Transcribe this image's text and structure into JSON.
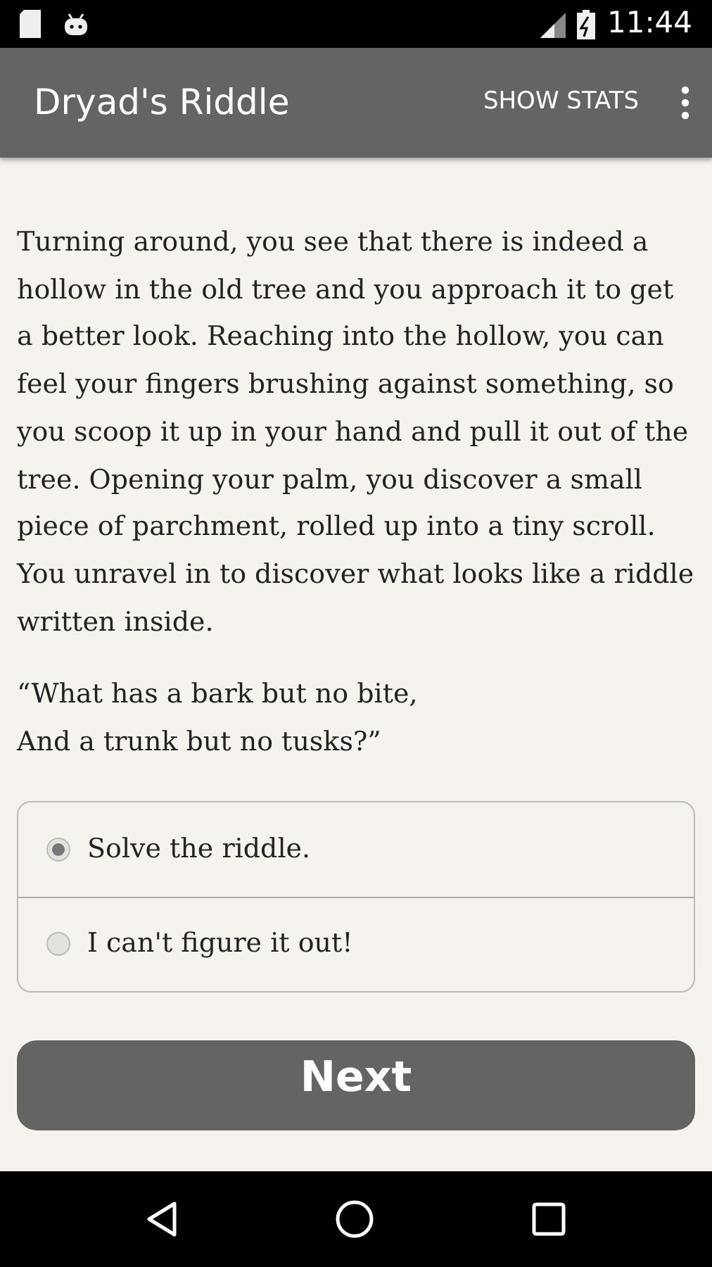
{
  "status_bar": {
    "time": "11:44"
  },
  "app_bar": {
    "title": "Dryad's Riddle",
    "action": "SHOW STATS"
  },
  "story": "Turning around, you see that there is indeed a hollow in the old tree and you approach it to get a better look. Reaching into the hollow, you can feel your fingers brushing against something, so you scoop it up in your hand and pull it out of the tree. Opening your palm, you discover a small piece of parchment, rolled up into a tiny scroll. You unravel in to discover what looks like a riddle written inside.",
  "riddle": [
    "“What has a bark but no bite,",
    "And a trunk but no tusks?”"
  ],
  "choices": [
    {
      "label": "Solve the riddle.",
      "selected": true
    },
    {
      "label": "I can't figure it out!",
      "selected": false
    }
  ],
  "button": "Next"
}
